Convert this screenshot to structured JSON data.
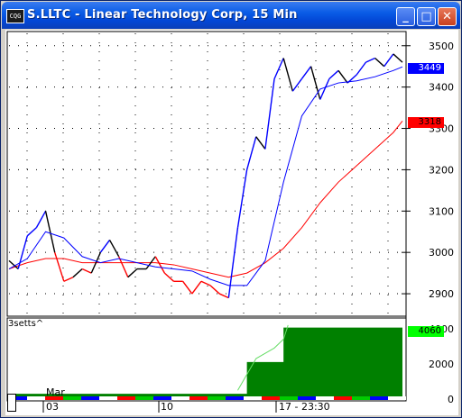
{
  "window": {
    "title": "S.LLTC - Linear Technology Corp, 15 Min",
    "icon": "app-chart-icon",
    "buttons": [
      "minimize",
      "maximize",
      "close"
    ]
  },
  "price_labels": {
    "current": "3449",
    "current_color": "#0000ff",
    "reference": "3318",
    "reference_color": "#ff0000"
  },
  "indicator": {
    "name": "3setts^",
    "value_label": "4060",
    "value_color": "#00ff00"
  },
  "chart_data": [
    {
      "type": "line",
      "title": "S.LLTC - Linear Technology Corp, 15 Min",
      "ylim": [
        2850,
        3530
      ],
      "yticks": [
        2900,
        3000,
        3100,
        3200,
        3300,
        3400,
        3500
      ],
      "ytick_labels": [
        "2900",
        "3000",
        "3100",
        "3200",
        "3300",
        "3400",
        "3500"
      ],
      "grid": true,
      "series": [
        {
          "role": "price",
          "colors": [
            "#000000",
            "#0000ff",
            "#ff0000"
          ],
          "x": [
            0,
            10,
            20,
            30,
            40,
            50,
            60,
            70,
            80,
            90,
            100,
            110,
            120,
            130,
            140,
            150,
            160,
            170,
            180,
            190,
            200,
            210,
            220,
            230,
            240,
            250,
            260,
            270,
            280,
            290,
            300,
            310,
            320,
            330,
            340,
            350,
            360,
            370,
            380,
            390,
            400,
            410,
            420,
            430
          ],
          "y": [
            2980,
            2960,
            3040,
            3060,
            3100,
            3000,
            2930,
            2940,
            2960,
            2950,
            3000,
            3030,
            2990,
            2940,
            2960,
            2960,
            2990,
            2950,
            2930,
            2930,
            2900,
            2930,
            2920,
            2900,
            2890,
            3060,
            3200,
            3280,
            3250,
            3420,
            3470,
            3390,
            3420,
            3450,
            3370,
            3420,
            3440,
            3410,
            3430,
            3460,
            3470,
            3450,
            3480,
            3460
          ]
        },
        {
          "role": "moving-average-fast",
          "color": "#0000ff",
          "x": [
            0,
            20,
            40,
            60,
            80,
            100,
            120,
            140,
            160,
            180,
            200,
            220,
            240,
            260,
            280,
            300,
            320,
            340,
            360,
            380,
            400,
            420,
            430
          ],
          "y": [
            2960,
            2985,
            3050,
            3035,
            2990,
            2975,
            2985,
            2975,
            2965,
            2960,
            2955,
            2935,
            2920,
            2920,
            2980,
            3170,
            3330,
            3395,
            3410,
            3415,
            3425,
            3440,
            3449
          ]
        },
        {
          "role": "moving-average-slow",
          "color": "#ff0000",
          "x": [
            0,
            20,
            40,
            60,
            80,
            100,
            120,
            140,
            160,
            180,
            200,
            220,
            240,
            260,
            280,
            300,
            320,
            340,
            360,
            380,
            400,
            420,
            430
          ],
          "y": [
            2960,
            2975,
            2985,
            2985,
            2975,
            2975,
            2975,
            2975,
            2975,
            2970,
            2960,
            2950,
            2940,
            2950,
            2975,
            3010,
            3060,
            3120,
            3170,
            3210,
            3250,
            3290,
            3318
          ]
        }
      ]
    },
    {
      "type": "area",
      "title": "3setts^",
      "ylim": [
        0,
        4500
      ],
      "yticks": [
        0,
        2000,
        4000
      ],
      "ytick_labels": [
        "0",
        "2000",
        "4000"
      ],
      "series": [
        {
          "role": "histogram",
          "color": "#008000",
          "x": [
            0,
            20,
            40,
            60,
            80,
            100,
            120,
            140,
            160,
            180,
            200,
            220,
            240,
            260,
            280,
            300,
            320,
            340,
            360,
            380,
            400,
            420,
            430
          ],
          "y": [
            300,
            300,
            300,
            300,
            300,
            300,
            300,
            300,
            300,
            300,
            300,
            300,
            300,
            2100,
            2100,
            4060,
            4060,
            4060,
            4060,
            4060,
            4060,
            4060,
            4060
          ]
        },
        {
          "role": "line",
          "color": "#66dd66",
          "x": [
            250,
            260,
            270,
            280,
            290,
            300,
            305
          ],
          "y": [
            500,
            1400,
            2300,
            2600,
            2900,
            3400,
            4200
          ]
        }
      ]
    }
  ],
  "x_axis": {
    "labels": [
      "Mar",
      "03",
      "10",
      "17 - 23:30"
    ]
  }
}
